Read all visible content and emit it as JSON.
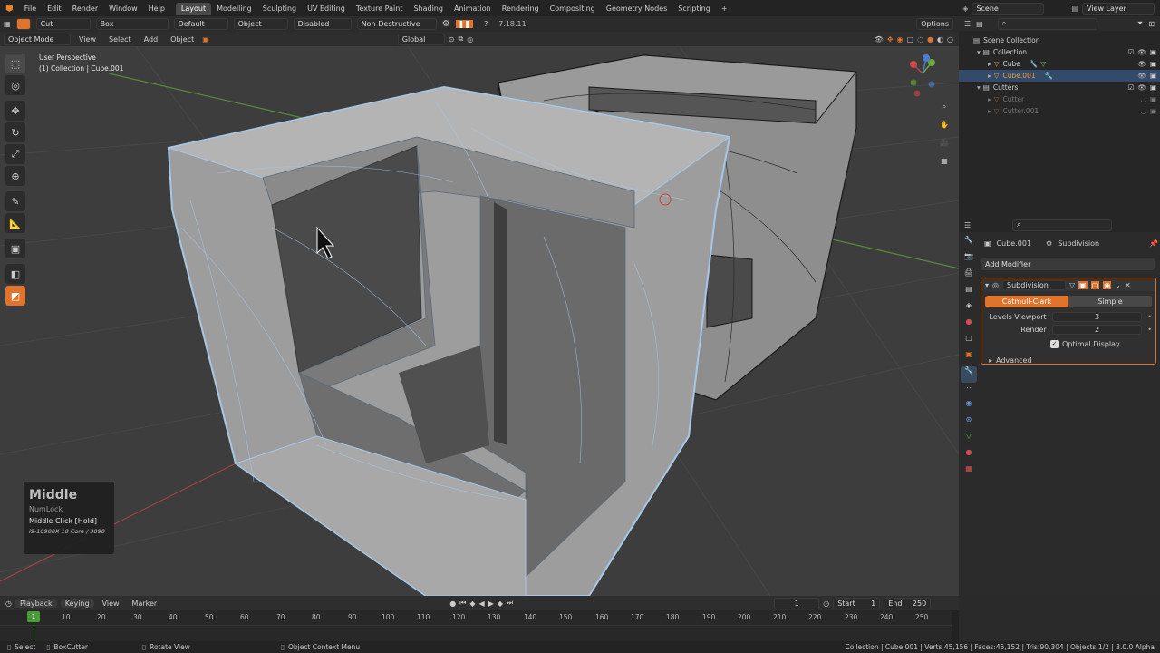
{
  "topbar": {
    "menus": [
      "File",
      "Edit",
      "Render",
      "Window",
      "Help"
    ],
    "workspaces": [
      "Layout",
      "Modelling",
      "Sculpting",
      "UV Editing",
      "Texture Paint",
      "Shading",
      "Animation",
      "Rendering",
      "Compositing",
      "Geometry Nodes",
      "Scripting"
    ],
    "active_workspace": "Layout",
    "add_tab": "+",
    "scene": "Scene",
    "view_layer": "View Layer"
  },
  "toolhdr": {
    "mode": "Cut",
    "shape": "Box",
    "default": "Default",
    "object": "Object",
    "disabled": "Disabled",
    "non_destructive": "Non-Destructive",
    "version": "7.18.11",
    "options": "Options"
  },
  "viewhdr": {
    "mode": "Object Mode",
    "menus": [
      "View",
      "Select",
      "Add",
      "Object"
    ],
    "transform": "Global"
  },
  "viewport": {
    "perspective": "User Perspective",
    "collection_info": "(1) Collection | Cube.001",
    "gizmo_axes": [
      "X",
      "Y",
      "Z"
    ]
  },
  "key_overlay": {
    "title": "Middle",
    "modifier": "NumLock",
    "action": "Middle Click [Hold]",
    "hardware": "i9-10900X 10 Core / 3090"
  },
  "outliner": {
    "items": [
      {
        "label": "Scene Collection",
        "indent": 0
      },
      {
        "label": "Collection",
        "indent": 1
      },
      {
        "label": "Cube",
        "indent": 2
      },
      {
        "label": "Cube.001",
        "indent": 2
      },
      {
        "label": "Cutters",
        "indent": 1
      },
      {
        "label": "Cutter",
        "indent": 2
      },
      {
        "label": "Cutter.001",
        "indent": 2
      }
    ]
  },
  "properties": {
    "object_name": "Cube.001",
    "modifier_type": "Subdivision",
    "add_modifier": "Add Modifier",
    "modifier_name": "Subdivision",
    "algo_options": [
      "Catmull-Clark",
      "Simple"
    ],
    "levels_viewport_label": "Levels Viewport",
    "levels_viewport": "3",
    "render_label": "Render",
    "render": "2",
    "optimal_display": "Optimal Display",
    "advanced": "Advanced"
  },
  "timeline": {
    "menus": [
      "Playback",
      "Keying",
      "View",
      "Marker"
    ],
    "current_frame": "1",
    "start_label": "Start",
    "start": "1",
    "end_label": "End",
    "end": "250",
    "ticks": [
      "1",
      "10",
      "20",
      "30",
      "40",
      "50",
      "60",
      "70",
      "80",
      "90",
      "100",
      "110",
      "120",
      "130",
      "140",
      "150",
      "160",
      "170",
      "180",
      "190",
      "200",
      "210",
      "220",
      "230",
      "240",
      "250"
    ]
  },
  "statusbar": {
    "select": "Select",
    "boxcutter": "BoxCutter",
    "rotate": "Rotate View",
    "context": "Object Context Menu",
    "stats": "Collection | Cube.001 | Verts:45,156 | Faces:45,152 | Tris:90,304 | Objects:1/2 | 3.0.0 Alpha"
  },
  "colors": {
    "accent": "#e0742c",
    "selection_outline": "#a6c8e8",
    "active_object_text": "#e8a13a"
  }
}
